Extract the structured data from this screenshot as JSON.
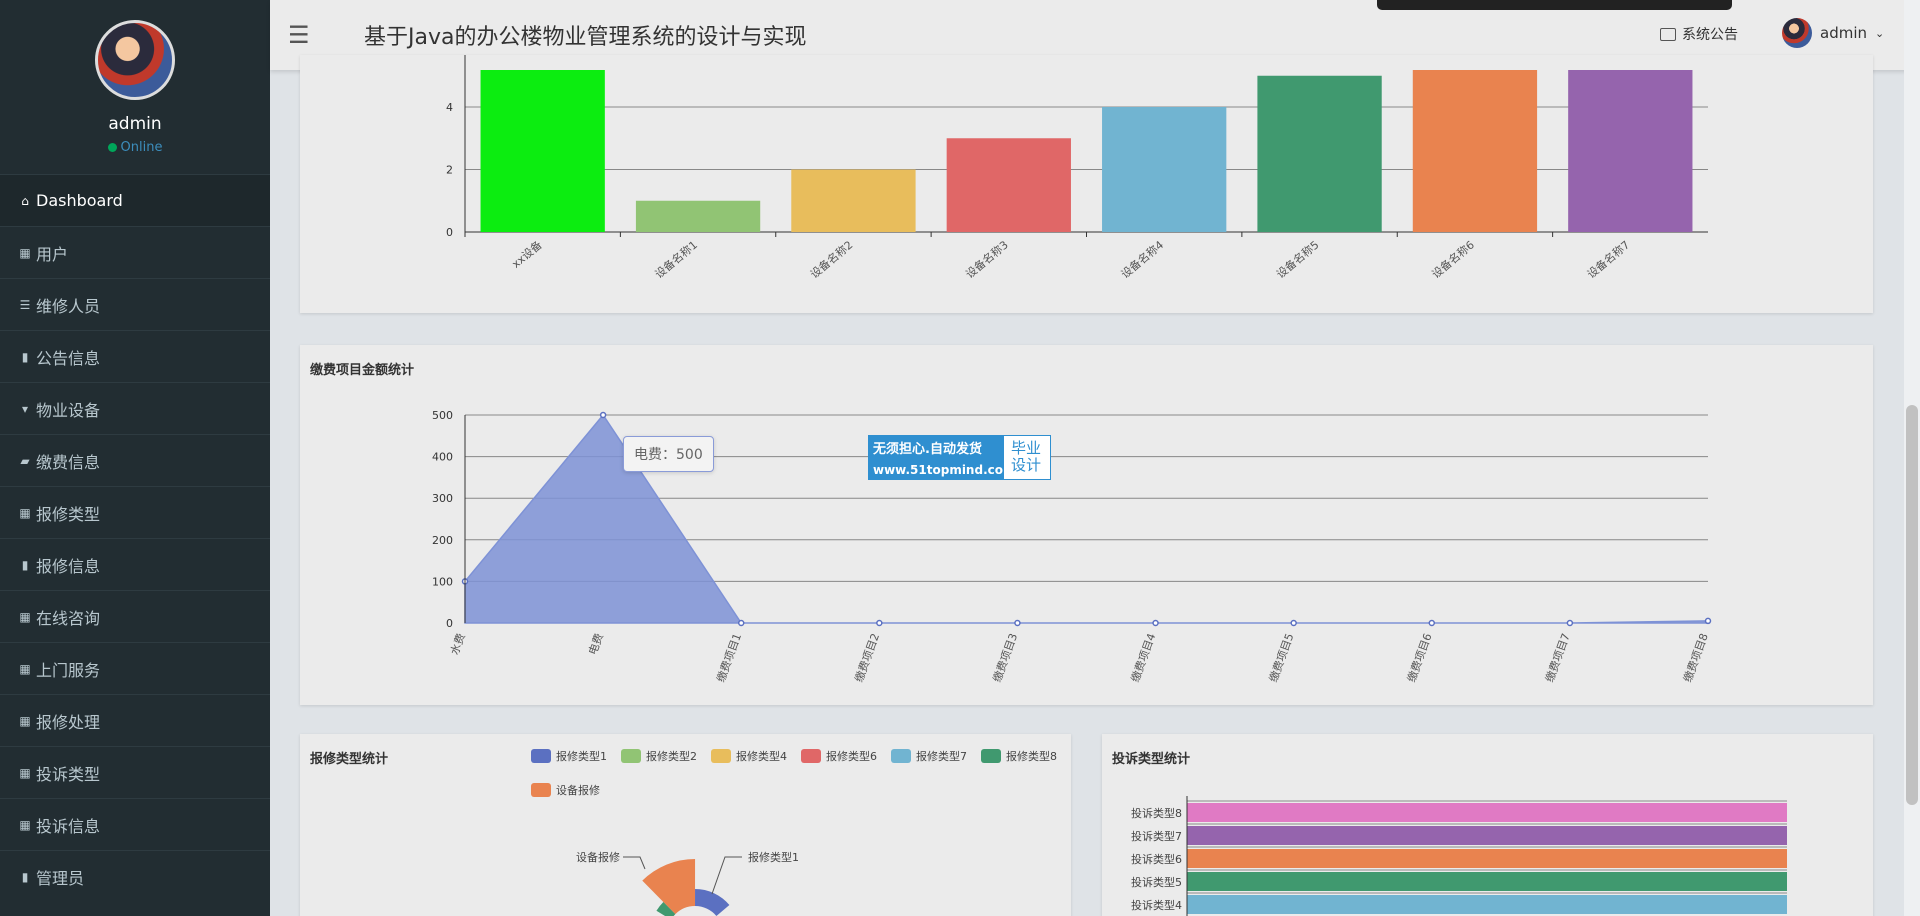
{
  "sidebar": {
    "user_name": "admin",
    "status": "Online",
    "items": [
      {
        "label": "Dashboard",
        "icon": "home-icon",
        "glyph": "⌂"
      },
      {
        "label": "用户",
        "icon": "grid-icon",
        "glyph": "▦"
      },
      {
        "label": "维修人员",
        "icon": "sliders-icon",
        "glyph": "☰"
      },
      {
        "label": "公告信息",
        "icon": "clipboard-icon",
        "glyph": "▮"
      },
      {
        "label": "物业设备",
        "icon": "device-icon",
        "glyph": "▾"
      },
      {
        "label": "缴费信息",
        "icon": "wallet-icon",
        "glyph": "▰"
      },
      {
        "label": "报修类型",
        "icon": "grid-icon",
        "glyph": "▦"
      },
      {
        "label": "报修信息",
        "icon": "bar-chart-icon",
        "glyph": "▮"
      },
      {
        "label": "在线咨询",
        "icon": "grid-icon",
        "glyph": "▦"
      },
      {
        "label": "上门服务",
        "icon": "grid-icon",
        "glyph": "▦"
      },
      {
        "label": "报修处理",
        "icon": "grid-icon",
        "glyph": "▦"
      },
      {
        "label": "投诉类型",
        "icon": "grid-icon",
        "glyph": "▦"
      },
      {
        "label": "投诉信息",
        "icon": "grid-icon",
        "glyph": "▦"
      },
      {
        "label": "管理员",
        "icon": "clipboard-icon",
        "glyph": "▮"
      }
    ]
  },
  "header": {
    "title": "基于Java的办公楼物业管理系统的设计与实现",
    "notice_label": "系统公告",
    "user_label": "admin"
  },
  "chart_data": [
    {
      "type": "bar",
      "title": "",
      "categories": [
        "xx设备",
        "设备名称1",
        "设备名称2",
        "设备名称3",
        "设备名称4",
        "设备名称5",
        "设备名称6",
        "设备名称7"
      ],
      "values": [
        6,
        1,
        2,
        3,
        4,
        5,
        6,
        7
      ],
      "colors": [
        "#0ced10",
        "#91c474",
        "#e8bd5c",
        "#e06767",
        "#71b4d1",
        "#40996f",
        "#e9834f",
        "#9564ad"
      ],
      "yticks": [
        0,
        2,
        4
      ],
      "ylim": [
        0,
        8
      ]
    },
    {
      "type": "area",
      "title": "缴费项目金额统计",
      "categories": [
        "水费",
        "电费",
        "缴费项目1",
        "缴费项目2",
        "缴费项目3",
        "缴费项目4",
        "缴费项目5",
        "缴费项目6",
        "缴费项目7",
        "缴费项目8"
      ],
      "values": [
        100,
        500,
        0,
        0,
        0,
        0,
        0,
        0,
        0,
        5
      ],
      "ylim": [
        0,
        500
      ],
      "yticks": [
        0,
        100,
        200,
        300,
        400,
        500
      ],
      "color": "#7e92d6",
      "tooltip": "电费：500"
    },
    {
      "type": "pie",
      "title": "报修类型统计",
      "legend": [
        "报修类型1",
        "报修类型2",
        "报修类型4",
        "报修类型6",
        "报修类型7",
        "报修类型8",
        "设备报修"
      ],
      "colors": [
        "#5b70c1",
        "#91c474",
        "#e8bd5c",
        "#e06767",
        "#71b4d1",
        "#40996f",
        "#e9834f"
      ],
      "visible_labels": [
        "设备报修",
        "报修类型1"
      ]
    },
    {
      "type": "bar",
      "title": "投诉类型统计",
      "categories": [
        "投诉类型8",
        "投诉类型7",
        "投诉类型6",
        "投诉类型5",
        "投诉类型4"
      ],
      "colors": [
        "#e07ac4",
        "#9564ad",
        "#e9834f",
        "#40996f",
        "#71b4d1"
      ]
    }
  ],
  "watermark": {
    "line1": "无须担心.自动发货",
    "line2": "www.51topmind.com",
    "side": "毕业设计"
  }
}
